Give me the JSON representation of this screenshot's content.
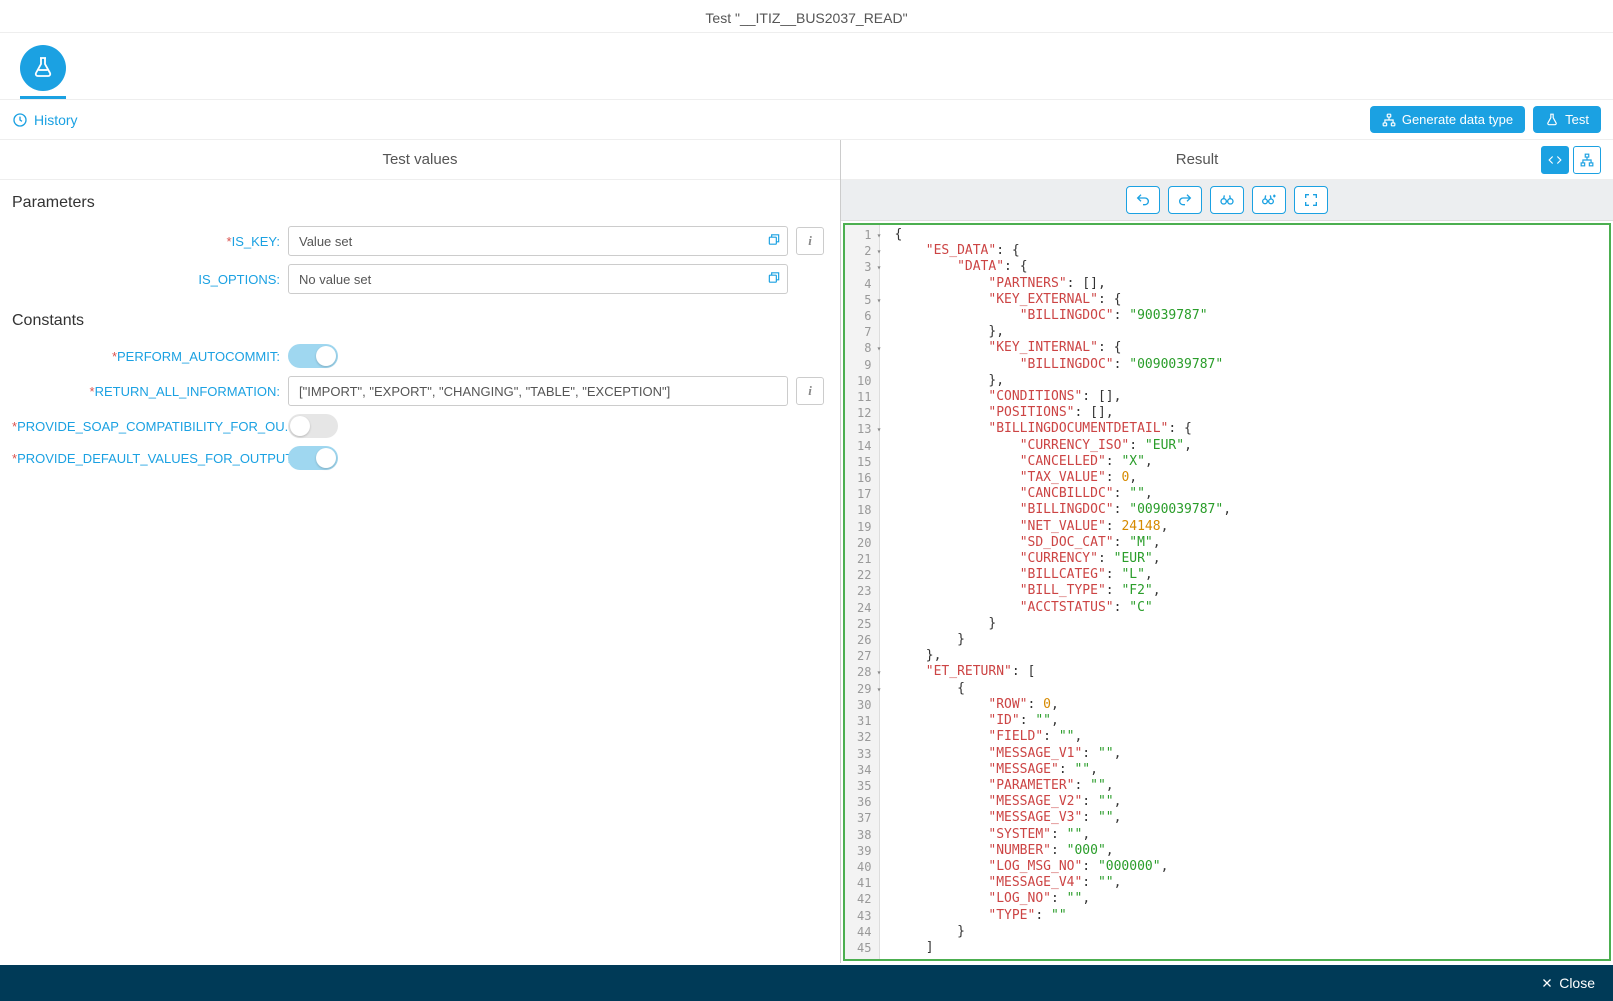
{
  "header": {
    "title": "Test \"__ITIZ__BUS2037_READ\"",
    "history_label": "History",
    "generate_button": "Generate data type",
    "test_button": "Test"
  },
  "panes": {
    "test_values_title": "Test values",
    "result_title": "Result"
  },
  "parameters": {
    "heading": "Parameters",
    "rows": [
      {
        "label": "IS_KEY:",
        "required": true,
        "value": "Value set",
        "has_info": true
      },
      {
        "label": "IS_OPTIONS:",
        "required": false,
        "value": "No value set",
        "has_info": false
      }
    ]
  },
  "constants": {
    "heading": "Constants",
    "rows": [
      {
        "label": "PERFORM_AUTOCOMMIT:",
        "required": true,
        "type": "toggle",
        "on": true
      },
      {
        "label": "RETURN_ALL_INFORMATION:",
        "required": true,
        "type": "input",
        "value": "[\"IMPORT\", \"EXPORT\", \"CHANGING\", \"TABLE\", \"EXCEPTION\"]",
        "has_info": true
      },
      {
        "label": "PROVIDE_SOAP_COMPATIBILITY_FOR_OU...:",
        "required": true,
        "type": "toggle",
        "on": false
      },
      {
        "label": "PROVIDE_DEFAULT_VALUES_FOR_OUTPUT:",
        "required": true,
        "type": "toggle",
        "on": true
      }
    ]
  },
  "code": {
    "lines": [
      {
        "n": 1,
        "fold": true,
        "tokens": [
          [
            "punc",
            "{"
          ]
        ]
      },
      {
        "n": 2,
        "fold": true,
        "indent": 1,
        "tokens": [
          [
            "key",
            "\"ES_DATA\""
          ],
          [
            "punc",
            ": {"
          ]
        ]
      },
      {
        "n": 3,
        "fold": true,
        "indent": 2,
        "tokens": [
          [
            "key",
            "\"DATA\""
          ],
          [
            "punc",
            ": {"
          ]
        ]
      },
      {
        "n": 4,
        "indent": 3,
        "tokens": [
          [
            "key",
            "\"PARTNERS\""
          ],
          [
            "punc",
            ": [],"
          ]
        ]
      },
      {
        "n": 5,
        "fold": true,
        "indent": 3,
        "tokens": [
          [
            "key",
            "\"KEY_EXTERNAL\""
          ],
          [
            "punc",
            ": {"
          ]
        ]
      },
      {
        "n": 6,
        "indent": 4,
        "tokens": [
          [
            "key",
            "\"BILLINGDOC\""
          ],
          [
            "punc",
            ": "
          ],
          [
            "str",
            "\"90039787\""
          ]
        ]
      },
      {
        "n": 7,
        "indent": 3,
        "tokens": [
          [
            "punc",
            "},"
          ]
        ]
      },
      {
        "n": 8,
        "fold": true,
        "indent": 3,
        "tokens": [
          [
            "key",
            "\"KEY_INTERNAL\""
          ],
          [
            "punc",
            ": {"
          ]
        ]
      },
      {
        "n": 9,
        "indent": 4,
        "tokens": [
          [
            "key",
            "\"BILLINGDOC\""
          ],
          [
            "punc",
            ": "
          ],
          [
            "str",
            "\"0090039787\""
          ]
        ]
      },
      {
        "n": 10,
        "indent": 3,
        "tokens": [
          [
            "punc",
            "},"
          ]
        ]
      },
      {
        "n": 11,
        "indent": 3,
        "tokens": [
          [
            "key",
            "\"CONDITIONS\""
          ],
          [
            "punc",
            ": [],"
          ]
        ]
      },
      {
        "n": 12,
        "indent": 3,
        "tokens": [
          [
            "key",
            "\"POSITIONS\""
          ],
          [
            "punc",
            ": [],"
          ]
        ]
      },
      {
        "n": 13,
        "fold": true,
        "indent": 3,
        "tokens": [
          [
            "key",
            "\"BILLINGDOCUMENTDETAIL\""
          ],
          [
            "punc",
            ": {"
          ]
        ]
      },
      {
        "n": 14,
        "indent": 4,
        "tokens": [
          [
            "key",
            "\"CURRENCY_ISO\""
          ],
          [
            "punc",
            ": "
          ],
          [
            "str",
            "\"EUR\""
          ],
          [
            "punc",
            ","
          ]
        ]
      },
      {
        "n": 15,
        "indent": 4,
        "tokens": [
          [
            "key",
            "\"CANCELLED\""
          ],
          [
            "punc",
            ": "
          ],
          [
            "str",
            "\"X\""
          ],
          [
            "punc",
            ","
          ]
        ]
      },
      {
        "n": 16,
        "indent": 4,
        "tokens": [
          [
            "key",
            "\"TAX_VALUE\""
          ],
          [
            "punc",
            ": "
          ],
          [
            "num",
            "0"
          ],
          [
            "punc",
            ","
          ]
        ]
      },
      {
        "n": 17,
        "indent": 4,
        "tokens": [
          [
            "key",
            "\"CANCBILLDC\""
          ],
          [
            "punc",
            ": "
          ],
          [
            "str",
            "\"\""
          ],
          [
            "punc",
            ","
          ]
        ]
      },
      {
        "n": 18,
        "indent": 4,
        "tokens": [
          [
            "key",
            "\"BILLINGDOC\""
          ],
          [
            "punc",
            ": "
          ],
          [
            "str",
            "\"0090039787\""
          ],
          [
            "punc",
            ","
          ]
        ]
      },
      {
        "n": 19,
        "indent": 4,
        "tokens": [
          [
            "key",
            "\"NET_VALUE\""
          ],
          [
            "punc",
            ": "
          ],
          [
            "num",
            "24148"
          ],
          [
            "punc",
            ","
          ]
        ]
      },
      {
        "n": 20,
        "indent": 4,
        "tokens": [
          [
            "key",
            "\"SD_DOC_CAT\""
          ],
          [
            "punc",
            ": "
          ],
          [
            "str",
            "\"M\""
          ],
          [
            "punc",
            ","
          ]
        ]
      },
      {
        "n": 21,
        "indent": 4,
        "tokens": [
          [
            "key",
            "\"CURRENCY\""
          ],
          [
            "punc",
            ": "
          ],
          [
            "str",
            "\"EUR\""
          ],
          [
            "punc",
            ","
          ]
        ]
      },
      {
        "n": 22,
        "indent": 4,
        "tokens": [
          [
            "key",
            "\"BILLCATEG\""
          ],
          [
            "punc",
            ": "
          ],
          [
            "str",
            "\"L\""
          ],
          [
            "punc",
            ","
          ]
        ]
      },
      {
        "n": 23,
        "indent": 4,
        "tokens": [
          [
            "key",
            "\"BILL_TYPE\""
          ],
          [
            "punc",
            ": "
          ],
          [
            "str",
            "\"F2\""
          ],
          [
            "punc",
            ","
          ]
        ]
      },
      {
        "n": 24,
        "indent": 4,
        "tokens": [
          [
            "key",
            "\"ACCTSTATUS\""
          ],
          [
            "punc",
            ": "
          ],
          [
            "str",
            "\"C\""
          ]
        ]
      },
      {
        "n": 25,
        "indent": 3,
        "tokens": [
          [
            "punc",
            "}"
          ]
        ]
      },
      {
        "n": 26,
        "indent": 2,
        "tokens": [
          [
            "punc",
            "}"
          ]
        ]
      },
      {
        "n": 27,
        "indent": 1,
        "tokens": [
          [
            "punc",
            "},"
          ]
        ]
      },
      {
        "n": 28,
        "fold": true,
        "indent": 1,
        "tokens": [
          [
            "key",
            "\"ET_RETURN\""
          ],
          [
            "punc",
            ": ["
          ]
        ]
      },
      {
        "n": 29,
        "fold": true,
        "indent": 2,
        "tokens": [
          [
            "punc",
            "{"
          ]
        ]
      },
      {
        "n": 30,
        "indent": 3,
        "tokens": [
          [
            "key",
            "\"ROW\""
          ],
          [
            "punc",
            ": "
          ],
          [
            "num",
            "0"
          ],
          [
            "punc",
            ","
          ]
        ]
      },
      {
        "n": 31,
        "indent": 3,
        "tokens": [
          [
            "key",
            "\"ID\""
          ],
          [
            "punc",
            ": "
          ],
          [
            "str",
            "\"\""
          ],
          [
            "punc",
            ","
          ]
        ]
      },
      {
        "n": 32,
        "indent": 3,
        "tokens": [
          [
            "key",
            "\"FIELD\""
          ],
          [
            "punc",
            ": "
          ],
          [
            "str",
            "\"\""
          ],
          [
            "punc",
            ","
          ]
        ]
      },
      {
        "n": 33,
        "indent": 3,
        "tokens": [
          [
            "key",
            "\"MESSAGE_V1\""
          ],
          [
            "punc",
            ": "
          ],
          [
            "str",
            "\"\""
          ],
          [
            "punc",
            ","
          ]
        ]
      },
      {
        "n": 34,
        "indent": 3,
        "tokens": [
          [
            "key",
            "\"MESSAGE\""
          ],
          [
            "punc",
            ": "
          ],
          [
            "str",
            "\"\""
          ],
          [
            "punc",
            ","
          ]
        ]
      },
      {
        "n": 35,
        "indent": 3,
        "tokens": [
          [
            "key",
            "\"PARAMETER\""
          ],
          [
            "punc",
            ": "
          ],
          [
            "str",
            "\"\""
          ],
          [
            "punc",
            ","
          ]
        ]
      },
      {
        "n": 36,
        "indent": 3,
        "tokens": [
          [
            "key",
            "\"MESSAGE_V2\""
          ],
          [
            "punc",
            ": "
          ],
          [
            "str",
            "\"\""
          ],
          [
            "punc",
            ","
          ]
        ]
      },
      {
        "n": 37,
        "indent": 3,
        "tokens": [
          [
            "key",
            "\"MESSAGE_V3\""
          ],
          [
            "punc",
            ": "
          ],
          [
            "str",
            "\"\""
          ],
          [
            "punc",
            ","
          ]
        ]
      },
      {
        "n": 38,
        "indent": 3,
        "tokens": [
          [
            "key",
            "\"SYSTEM\""
          ],
          [
            "punc",
            ": "
          ],
          [
            "str",
            "\"\""
          ],
          [
            "punc",
            ","
          ]
        ]
      },
      {
        "n": 39,
        "indent": 3,
        "tokens": [
          [
            "key",
            "\"NUMBER\""
          ],
          [
            "punc",
            ": "
          ],
          [
            "str",
            "\"000\""
          ],
          [
            "punc",
            ","
          ]
        ]
      },
      {
        "n": 40,
        "indent": 3,
        "tokens": [
          [
            "key",
            "\"LOG_MSG_NO\""
          ],
          [
            "punc",
            ": "
          ],
          [
            "str",
            "\"000000\""
          ],
          [
            "punc",
            ","
          ]
        ]
      },
      {
        "n": 41,
        "indent": 3,
        "tokens": [
          [
            "key",
            "\"MESSAGE_V4\""
          ],
          [
            "punc",
            ": "
          ],
          [
            "str",
            "\"\""
          ],
          [
            "punc",
            ","
          ]
        ]
      },
      {
        "n": 42,
        "indent": 3,
        "tokens": [
          [
            "key",
            "\"LOG_NO\""
          ],
          [
            "punc",
            ": "
          ],
          [
            "str",
            "\"\""
          ],
          [
            "punc",
            ","
          ]
        ]
      },
      {
        "n": 43,
        "indent": 3,
        "tokens": [
          [
            "key",
            "\"TYPE\""
          ],
          [
            "punc",
            ": "
          ],
          [
            "str",
            "\"\""
          ]
        ]
      },
      {
        "n": 44,
        "indent": 2,
        "tokens": [
          [
            "punc",
            "}"
          ]
        ]
      },
      {
        "n": 45,
        "indent": 1,
        "tokens": [
          [
            "punc",
            "]"
          ]
        ]
      }
    ]
  },
  "footer": {
    "close_label": "Close"
  }
}
